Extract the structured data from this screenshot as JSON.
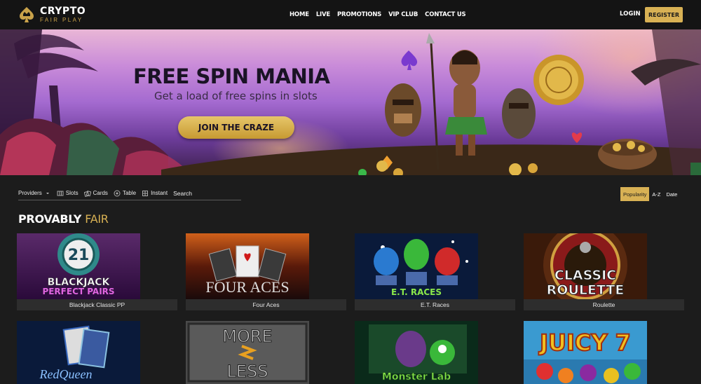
{
  "header": {
    "logo_title": "CRYPTO",
    "logo_sub": "FAIR PLAY",
    "nav": [
      "HOME",
      "LIVE",
      "PROMOTIONS",
      "VIP CLUB",
      "CONTACT US"
    ],
    "login": "LOGIN",
    "register": "REGISTER"
  },
  "banner": {
    "title": "FREE SPIN MANIA",
    "subtitle": "Get a load of free spins in slots",
    "cta": "JOIN THE CRAZE"
  },
  "filters": {
    "providers": "Providers",
    "slots": "Slots",
    "cards": "Cards",
    "table": "Table",
    "instant": "Instant",
    "search_placeholder": "Search"
  },
  "sort": {
    "options": [
      "Popularity",
      "A-Z",
      "Date"
    ],
    "active": "Popularity"
  },
  "section": {
    "title_main": "PROVABLY",
    "title_accent": "FAIR"
  },
  "games": [
    {
      "name": "Blackjack Classic PP",
      "art_line1": "21",
      "art_line2": "BLACKJACK",
      "art_line3": "PERFECT PAIRS"
    },
    {
      "name": "Four Aces",
      "art_line1": "FOUR ACES"
    },
    {
      "name": "E.T. Races",
      "art_line1": "E.T. RACES"
    },
    {
      "name": "Roulette",
      "art_line1": "CLASSIC",
      "art_line2": "ROULETTE"
    },
    {
      "art_line1": "RedQueen"
    },
    {
      "art_line1": "MORE",
      "art_line2": "LESS"
    },
    {
      "art_line1": "Monster Lab"
    },
    {
      "art_line1": "JUICY 7"
    }
  ],
  "colors": {
    "accent": "#d8b154",
    "background": "#1c1c1c",
    "header_bg": "#141414",
    "label_bar": "#2d2d2d"
  }
}
